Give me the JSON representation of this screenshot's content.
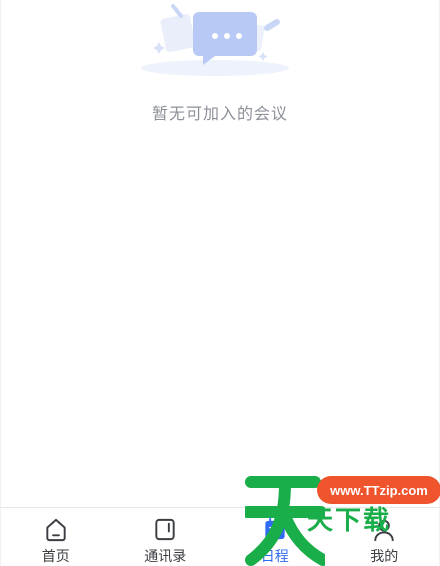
{
  "empty_state": {
    "message": "暂无可加入的会议"
  },
  "tabbar": {
    "tabs": [
      {
        "label": "首页",
        "icon": "home-icon"
      },
      {
        "label": "通讯录",
        "icon": "contacts-icon"
      },
      {
        "label": "日程",
        "icon": "calendar-icon",
        "active": true
      },
      {
        "label": "我的",
        "icon": "profile-icon"
      }
    ]
  },
  "watermark": {
    "badge": "www.TTzip.com",
    "logo_glyph": "天",
    "text": "天下载"
  },
  "colors": {
    "accent": "#2f6bf2",
    "empty_text": "#8c9099",
    "watermark_green": "#1aae4a",
    "watermark_orange": "#f0542d"
  }
}
